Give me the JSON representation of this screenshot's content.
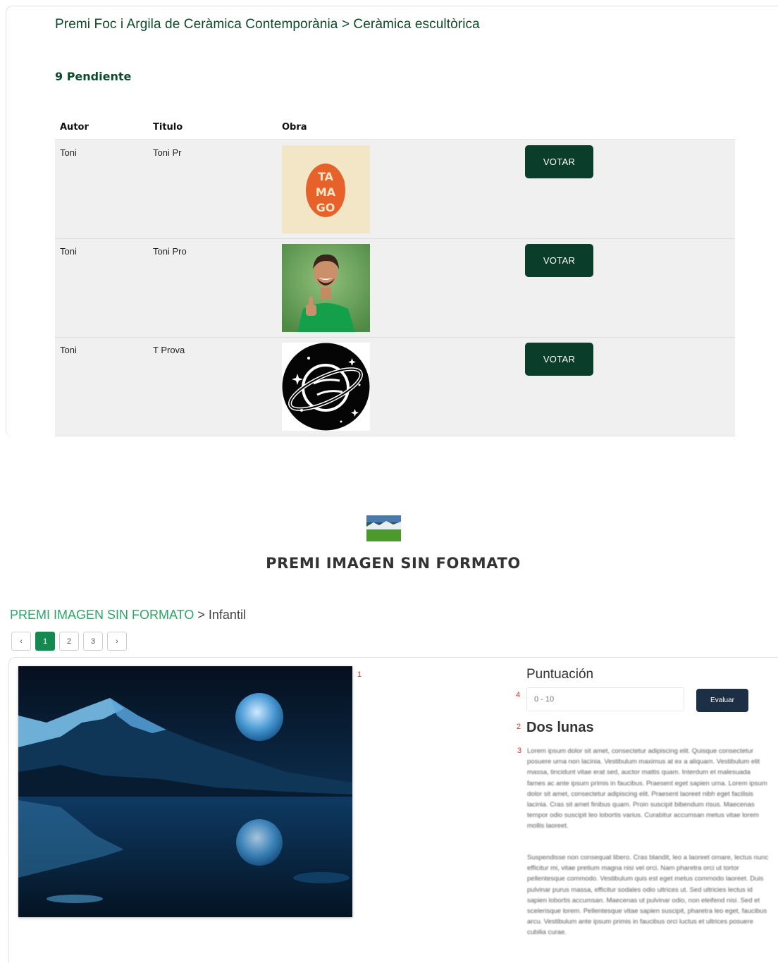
{
  "top": {
    "breadcrumb": "Premi Foc i Argila de Ceràmica Contemporània > Ceràmica escultòrica",
    "pending_title": "9 Pendiente",
    "columns": {
      "author": "Autor",
      "title": "Titulo",
      "work": "Obra"
    },
    "rows": [
      {
        "author": "Toni",
        "title": "Toni Pr",
        "image": "tamago-logo-image",
        "button": "VOTAR"
      },
      {
        "author": "Toni",
        "title": "Toni Pro",
        "image": "man-thumbs-up-photo",
        "button": "VOTAR"
      },
      {
        "author": "Toni",
        "title": "T Prova",
        "image": "planet-icon-image",
        "button": "VOTAR"
      }
    ]
  },
  "bottom": {
    "title": "PREMI IMAGEN SIN FORMATO",
    "breadcrumb_link": "PREMI IMAGEN SIN FORMATO",
    "breadcrumb_sep": ">",
    "breadcrumb_current": "Infantil",
    "pagination": {
      "prev": "‹",
      "pages": [
        "1",
        "2",
        "3"
      ],
      "active": "1",
      "next": "›"
    },
    "markers": {
      "m1": "1",
      "m2": "2",
      "m3": "3",
      "m4": "4"
    },
    "score_label": "Puntuación",
    "score_placeholder": "0 - 10",
    "evaluate_button": "Evaluar",
    "work_title": "Dos lunas",
    "description_p1": "Lorem ipsum dolor sit amet, consectetur adipiscing elit. Quisque consectetur posuere urna non lacinia. Vestibulum maximus at ex a aliquam. Vestibulum elit massa, tincidunt vitae erat sed, auctor mattis quam. Interdum et malesuada fames ac ante ipsum primis in faucibus. Praesent eget sapien urna. Lorem ipsum dolor sit amet, consectetur adipiscing elit. Praesent laoreet nibh eget facilisis lacinia. Cras sit amet finibus quam. Proin suscipit bibendum risus. Maecenas tempor odio suscipit leo lobortis varius. Curabitur accumsan metus vitae lorem mollis laoreet.",
    "description_p2": "Suspendisse non consequat libero. Cras blandit, leo a laoreet ornare, lectus nunc efficitur mi, vitae pretium magna nisi vel orci. Nam pharetra orci ut tortor pellentesque commodo. Vestibulum quis est eget metus commodo laoreet. Duis pulvinar purus massa, efficitur sodales odio ultrices ut. Sed ultricies lectus id sapien lobortis accumsan. Maecenas ut pulvinar odio, non eleifend nisi. Sed et scelerisque lorem. Pellentesque vitae sapien suscipit, pharetra leo eget, faucibus arcu. Vestibulum ante ipsum primis in faucibus orci luctus et ultrices posuere cubilia curae."
  }
}
